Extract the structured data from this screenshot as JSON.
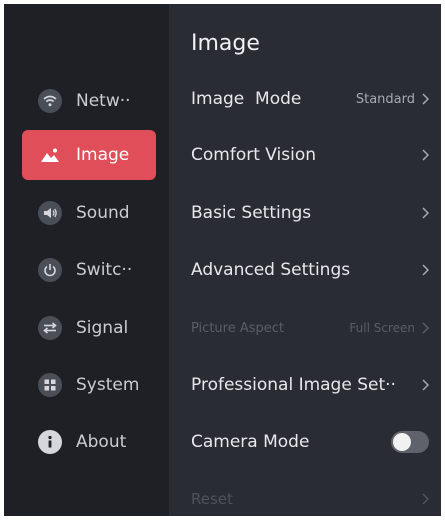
{
  "sidebar": {
    "items": [
      {
        "label": "Netw··",
        "icon": "wifi-icon"
      },
      {
        "label": "Image",
        "icon": "image-icon",
        "active": true
      },
      {
        "label": "Sound",
        "icon": "speaker-icon"
      },
      {
        "label": "Switc··",
        "icon": "power-icon"
      },
      {
        "label": "Signal",
        "icon": "signal-icon"
      },
      {
        "label": "System",
        "icon": "grid-icon"
      },
      {
        "label": "About",
        "icon": "info-icon"
      }
    ]
  },
  "panel": {
    "title": "Image",
    "rows": [
      {
        "label": "Image  Mode",
        "value": "Standard",
        "type": "link"
      },
      {
        "label": "Comfort Vision",
        "value": "",
        "type": "link"
      },
      {
        "label": "Basic Settings",
        "value": "",
        "type": "link"
      },
      {
        "label": "Advanced Settings",
        "value": "",
        "type": "link"
      },
      {
        "label": "Picture Aspect",
        "value": "Full Screen",
        "type": "link",
        "disabled": true
      },
      {
        "label": "Professional Image Set··",
        "value": "",
        "type": "link"
      },
      {
        "label": "Camera Mode",
        "value": "",
        "type": "toggle",
        "toggle_on": false
      },
      {
        "label": "Reset",
        "value": "",
        "type": "link",
        "faded": true
      }
    ]
  },
  "colors": {
    "accent": "#e04f59",
    "background": "#191b20",
    "panel": "#292c33"
  }
}
